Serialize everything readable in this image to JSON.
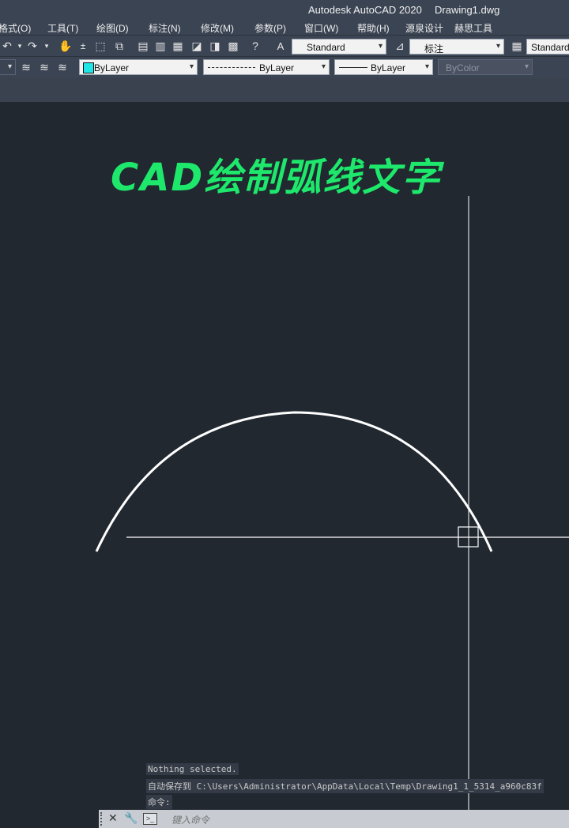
{
  "titlebar": {
    "app": "Autodesk AutoCAD 2020",
    "document": "Drawing1.dwg"
  },
  "menu": [
    "格式(O)",
    "工具(T)",
    "绘图(D)",
    "标注(N)",
    "修改(M)",
    "参数(P)",
    "窗口(W)",
    "帮助(H)",
    "源泉设计",
    "赫思工具"
  ],
  "toolbar": {
    "text_style": "Standard",
    "dim_style": "标注",
    "table_style": "Standard",
    "layer_color": "ByLayer",
    "linetype": "ByLayer",
    "lineweight": "ByLayer",
    "plot_style": "ByColor"
  },
  "canvas": {
    "title": "CAD绘制弧线文字",
    "title_color": "#1ee86b"
  },
  "command": {
    "history": [
      "Nothing selected.",
      "自动保存到 C:\\Users\\Administrator\\AppData\\Local\\Temp\\Drawing1_1_5314_a960c83f",
      "命令:"
    ],
    "placeholder": "键入命令"
  },
  "colors": {
    "background": "#212830",
    "toolbar": "#3b4453",
    "swatch": "#22e6e6"
  }
}
